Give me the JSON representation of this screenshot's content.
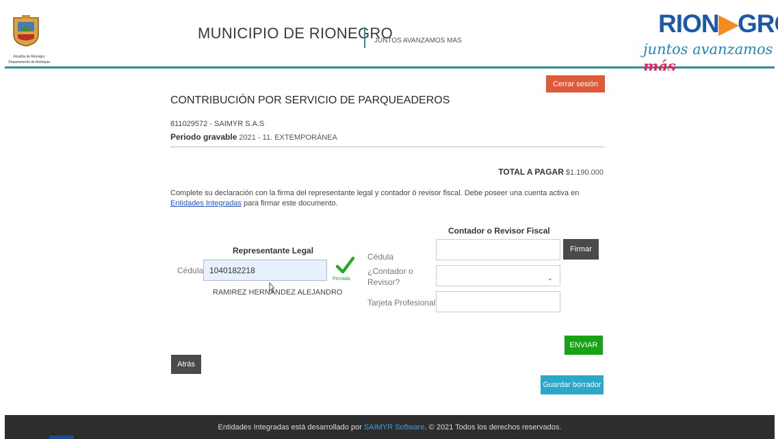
{
  "header": {
    "seal_caption_1": "Alcaldía de Rionegro",
    "seal_caption_2": "Departamento de Antioquia",
    "title": "MUNICIPIO DE RIONEGRO",
    "tagline": "JUNTOS AVANZAMOS MAS",
    "logo_word_a": "RION",
    "logo_word_arrow": "▶",
    "logo_word_b": "GRO",
    "logo_sub_a": "juntos avanzamos ",
    "logo_sub_b": "más"
  },
  "actions": {
    "logout": "Cerrar sesión",
    "firmar": "Firmar",
    "enviar": "ENVIAR",
    "atras": "Atrás",
    "guardar": "Guardar borrador"
  },
  "declaration": {
    "title": "CONTRIBUCIÓN POR SERVICIO DE PARQUEADEROS",
    "taxpayer": "811029572 - SAIMYR S.A.S",
    "period_label": "Periodo gravable",
    "period_value": " 2021 - 11. EXTEMPORÁNEA",
    "total_label": "TOTAL A PAGAR",
    "total_value": " $1.190.000",
    "instructions_pre": "Complete su declaración con la firma del representante legal y contador ó revisor fiscal. Debe poseer una cuenta activa en ",
    "instructions_link": "Entidades Integradas",
    "instructions_post": " para firmar este documento."
  },
  "representative": {
    "heading": "Representante Legal",
    "cedula_label": "Cédula",
    "cedula_value": "1040182218",
    "signed_label": "Firmada",
    "name": "RAMIREZ HERNANDEZ ALEJANDRO"
  },
  "accountant": {
    "heading": "Contador o Revisor Fiscal",
    "cedula_label": "Cédula",
    "cedula_value": "",
    "role_label_1": "¿Contador o",
    "role_label_2": "Revisor?",
    "role_selected": "",
    "card_label": "Tarjeta Profesional",
    "card_value": ""
  },
  "footer": {
    "pre": "Entidades Integradas está desarrollado por ",
    "link": "SAIMYR Software",
    "post": ". © 2021 Todos los derechos reservados."
  },
  "colors": {
    "accent_teal": "#2e8b9a",
    "logout": "#e05a37",
    "enviar": "#16a314",
    "guardar": "#2aa7c9",
    "dark_button": "#4a4a4a",
    "footer": "#2d2d2d"
  }
}
